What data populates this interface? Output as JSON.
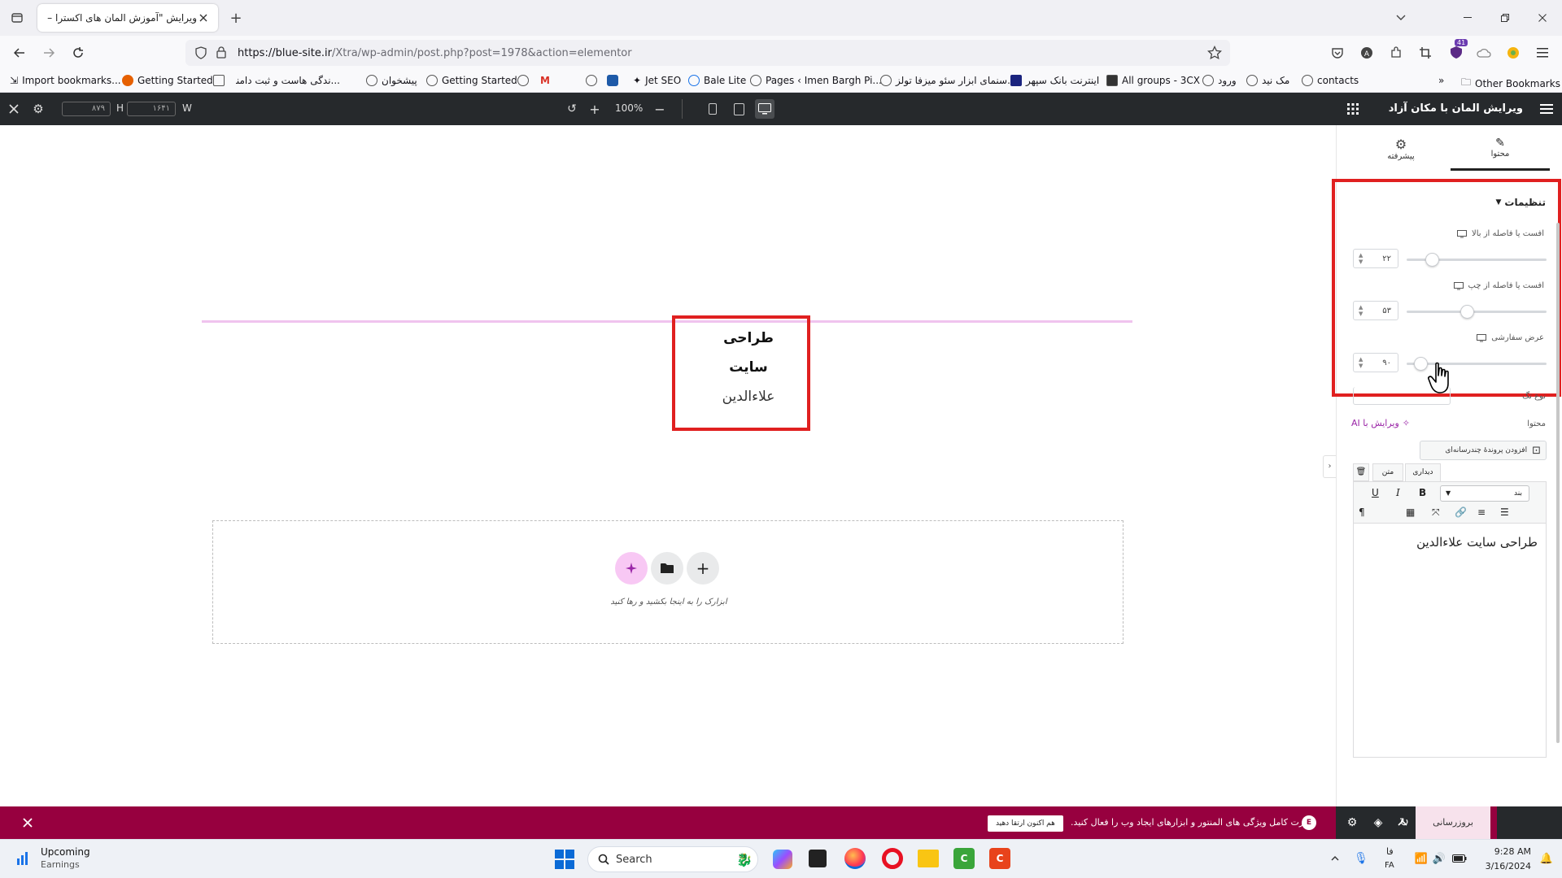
{
  "browser": {
    "tab_title": "ویرایش \"آموزش المان های اکسترا – ب",
    "url_host": "https://blue-site.ir",
    "url_path": "/Xtra/wp-admin/post.php?post=1978&action=elementor",
    "bookmarks": [
      {
        "label": "Import bookmarks..."
      },
      {
        "label": "Getting Started"
      },
      {
        "label": "...ندگی هاست و ثبت دامنه"
      },
      {
        "label": "پیشخوان"
      },
      {
        "label": "Getting Started"
      },
      {
        "label": "Jet SEO"
      },
      {
        "label": "Bale Lite"
      },
      {
        "label": "Pages ‹ Imen Bargh Pi..."
      },
      {
        "label": "...سنمای ابزار سئو میزفا تولز"
      },
      {
        "label": "اینترنت بانک سپهر"
      },
      {
        "label": "All groups - 3CX"
      },
      {
        "label": "ورود"
      },
      {
        "label": "مک نید"
      },
      {
        "label": "contacts"
      }
    ],
    "other_bookmarks": "Other Bookmarks",
    "extension_badge": "41"
  },
  "editor_top": {
    "height_value": "۸۷۹",
    "height_label": "H",
    "width_value": "۱۶۴۱",
    "width_label": "W",
    "zoom": "100%"
  },
  "panel": {
    "title": "ویرایش المان با مکان آزاد",
    "tabs": [
      {
        "label": "محتوا"
      },
      {
        "label": "پیشرفته"
      }
    ],
    "section_title": "تنظیمات",
    "fields": [
      {
        "label": "افست یا فاصله از بالا",
        "value": "۲۲",
        "slider_fraction": 0.18
      },
      {
        "label": "افست یا فاصله از چپ",
        "value": "۵۳",
        "slider_fraction": 0.43
      },
      {
        "label": "عرض سفارشی",
        "value": "۹۰",
        "slider_fraction": 0.1
      }
    ],
    "hidden_field_label": "نوع تگ",
    "content_label": "محتوا",
    "ai_button": "ویرایش با AI",
    "add_media": "افزودن پروندهٔ چندرسانه‌ای",
    "editor_tabs": [
      {
        "label": "دیداری"
      },
      {
        "label": "متن"
      }
    ],
    "format_select": "بند",
    "editor_content": "طراحی سایت علاءالدین"
  },
  "canvas": {
    "widget_lines": [
      "طراحی",
      "سایت",
      "علاءالدین"
    ],
    "drop_hint": "ابزارک را به اینجا بکشید و رها کنید"
  },
  "notice": {
    "message": "قدرت کامل ویژگی های المنتور و ابزارهای ایجاد وب را فعال کنید.",
    "cta": "هم اکنون ارتقا دهید",
    "update_label": "بروزرسانی"
  },
  "taskbar": {
    "widget_title": "Upcoming",
    "widget_subtitle": "Earnings",
    "search_placeholder": "Search",
    "lang_top": "فا",
    "lang_bottom": "FA",
    "time": "9:28 AM",
    "date": "3/16/2024"
  },
  "colors": {
    "editor_dark": "#26292c",
    "notice_bg": "#97003f",
    "highlight_red": "#e02020",
    "ai_purple": "#9b27a8",
    "pink_line": "#f0c3ee"
  }
}
